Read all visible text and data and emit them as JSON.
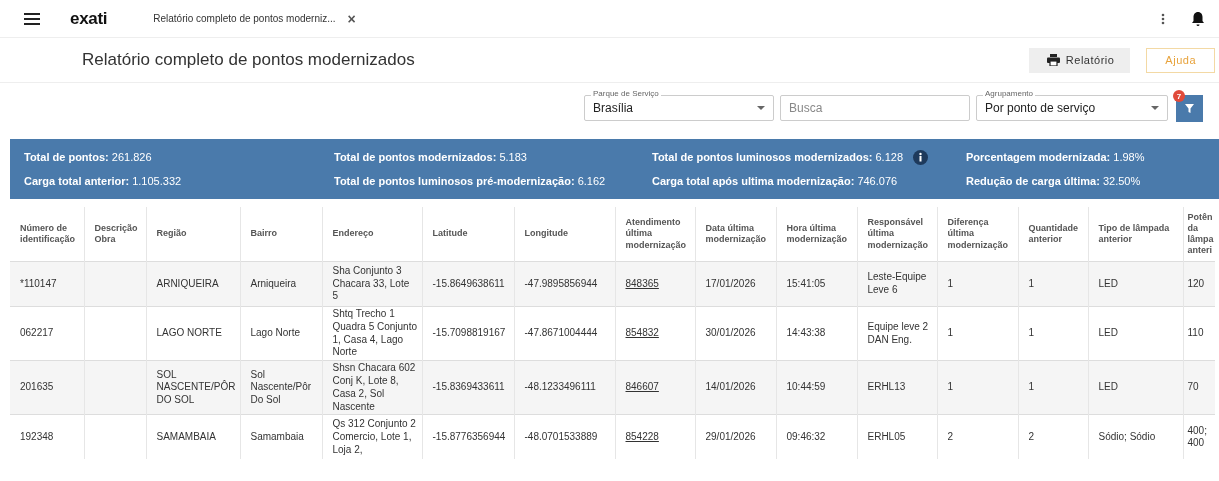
{
  "app_bar": {
    "logo": "exati",
    "tab": {
      "label": "Relatório completo de pontos moderniz...",
      "close": "×"
    }
  },
  "page": {
    "title": "Relatório completo de pontos modernizados",
    "buttons": [
      {
        "kind": "print",
        "label": "Relatório"
      },
      {
        "kind": "outline",
        "label": "Ajuda"
      }
    ]
  },
  "filters": {
    "service_park": {
      "label": "Parque de Serviço",
      "value": "Brasília"
    },
    "search": {
      "placeholder": "Busca"
    },
    "grouping": {
      "label": "Agrupamento",
      "value": "Por ponto de serviço"
    },
    "filter_badge": "7"
  },
  "summary": [
    {
      "text": "**Total de pontos:** 261.826",
      "info": false
    },
    {
      "text": "**Total de pontos modernizados:** 5.183",
      "info": false
    },
    {
      "text": "**Total de pontos luminosos modernizados:** 6.128",
      "info": true
    },
    {
      "text": "**Porcentagem modernizada:** 1.98%",
      "info": false
    },
    {
      "text": "**Carga total anterior:** 1.105.332",
      "info": false
    },
    {
      "text": "**Total de pontos luminosos pré-modernização:** 6.162",
      "info": false
    },
    {
      "text": "**Carga total após ultima modernização:** 746.076",
      "info": false
    },
    {
      "text": "**Redução de carga última:** 32.50%",
      "info": false
    }
  ],
  "table": {
    "columns": [
      "Número de identificação",
      "Descrição Obra",
      "Região",
      "Bairro",
      "Endereço",
      "Latitude",
      "Longitude",
      "Atendimento última modernização",
      "Data última modernização",
      "Hora última modernização",
      "Responsável última modernização",
      "Diferença última modernização",
      "Quantidade anterior",
      "Tipo de lâmpada anterior",
      "Potên da lâmpa anteri"
    ],
    "rows": [
      [
        "*110147",
        "",
        "ARNIQUEIRA",
        "Arniqueira",
        "Sha Conjunto 3 Chacara 33, Lote 5",
        "-15.8649638611",
        "-47.9895856944",
        "848365",
        "17/01/2026",
        "15:41:05",
        "Leste-Equipe Leve 6",
        "1",
        "1",
        "LED",
        "120"
      ],
      [
        "062217",
        "",
        "LAGO NORTE",
        "Lago Norte",
        "Shtq Trecho 1 Quadra 5 Conjunto 1, Casa 4, Lago Norte",
        "-15.7098819167",
        "-47.8671004444",
        "854832",
        "30/01/2026",
        "14:43:38",
        "Equipe leve 2 DAN Eng.",
        "1",
        "1",
        "LED",
        "110"
      ],
      [
        "201635",
        "",
        "SOL NASCENTE/PÔR DO SOL",
        "Sol Nascente/Pôr Do Sol",
        "Shsn Chacara 602 Conj K, Lote 8, Casa 2, Sol Nascente",
        "-15.8369433611",
        "-48.1233496111",
        "846607",
        "14/01/2026",
        "10:44:59",
        "ERHL13",
        "1",
        "1",
        "LED",
        "70"
      ],
      [
        "192348",
        "",
        "SAMAMBAIA",
        "Samambaia",
        "Qs 312 Conjunto 2 Comercio, Lote 1, Loja 2,",
        "-15.8776356944",
        "-48.0701533889",
        "854228",
        "29/01/2026",
        "09:46:32",
        "ERHL05",
        "2",
        "2",
        "Sódio; Sódio",
        "400; 400"
      ]
    ]
  }
}
